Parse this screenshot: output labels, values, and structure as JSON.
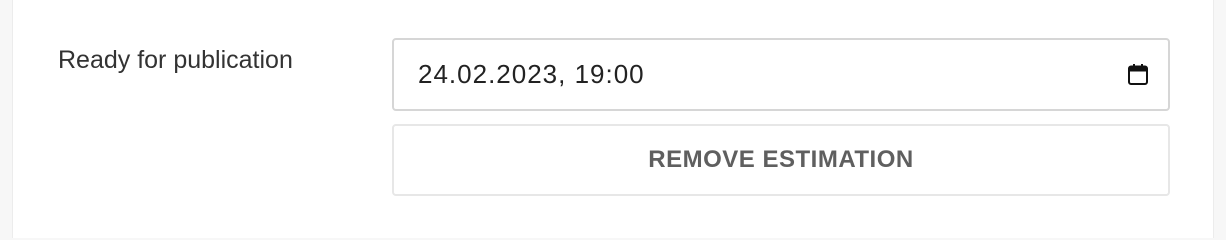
{
  "estimation": {
    "label": "Ready for publication",
    "datetime_value": "24.02.2023, 19:00",
    "calendar_icon": "calendar-icon",
    "remove_button_label": "REMOVE ESTIMATION"
  },
  "colors": {
    "page_background": "#f7f7f7",
    "panel_background": "#ffffff",
    "label_text": "#333333",
    "button_text": "#5f5f5f",
    "field_border": "#d6d6d6"
  }
}
